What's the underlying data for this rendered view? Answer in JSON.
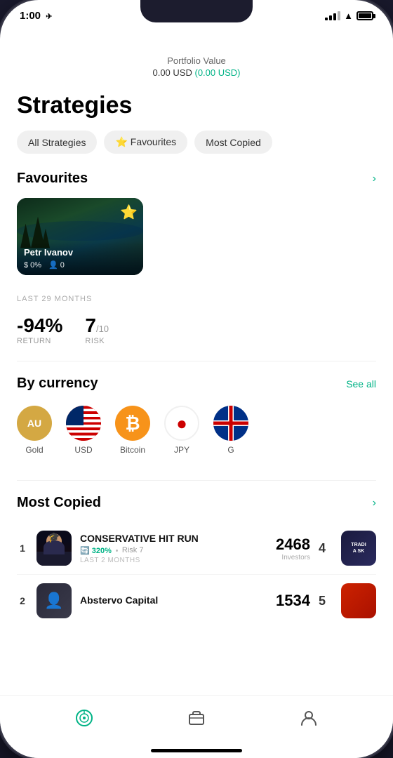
{
  "status": {
    "time": "1:00",
    "nav_icon": "✈"
  },
  "portfolio": {
    "label": "Portfolio Value",
    "value": "0.00 USD",
    "change": "(0.00 USD)"
  },
  "page": {
    "title": "Strategies"
  },
  "filters": [
    {
      "id": "all",
      "label": "All Strategies"
    },
    {
      "id": "fav",
      "label": "⭐ Favourites"
    },
    {
      "id": "copied",
      "label": "Most Copied"
    }
  ],
  "favourites": {
    "title": "Favourites",
    "items": [
      {
        "name": "Petr Ivanov",
        "return_pct": "0%",
        "copiers": "0",
        "is_starred": true
      }
    ],
    "period": "LAST 29 MONTHS",
    "return_value": "-94%",
    "return_label": "Return",
    "risk_value": "7",
    "risk_max": "/10",
    "risk_label": "Risk"
  },
  "currencies": {
    "title": "By currency",
    "see_all": "See all",
    "items": [
      {
        "id": "gold",
        "label": "Gold",
        "symbol": "AU"
      },
      {
        "id": "usd",
        "label": "USD",
        "symbol": ""
      },
      {
        "id": "btc",
        "label": "Bitcoin",
        "symbol": "₿"
      },
      {
        "id": "jpy",
        "label": "JPY",
        "symbol": "●"
      },
      {
        "id": "gb",
        "label": "G",
        "symbol": ""
      }
    ]
  },
  "most_copied": {
    "title": "Most Copied",
    "items": [
      {
        "rank": "1",
        "name": "CONSERVATIVE HIT RUN",
        "return": "320%",
        "risk": "Risk 7",
        "period": "LAST 2 MONTHS",
        "count": "2468",
        "count_label": "Investors",
        "right_rank": "4"
      },
      {
        "rank": "2",
        "name": "Abstervo Capital",
        "return": "",
        "risk": "",
        "period": "",
        "count": "1534",
        "count_label": "",
        "right_rank": "5"
      }
    ]
  },
  "nav": {
    "items": [
      {
        "id": "radar",
        "label": "",
        "icon": "⊙",
        "active": true
      },
      {
        "id": "portfolio",
        "label": "",
        "icon": "🗂",
        "active": false
      },
      {
        "id": "profile",
        "label": "",
        "icon": "👤",
        "active": false
      }
    ]
  }
}
